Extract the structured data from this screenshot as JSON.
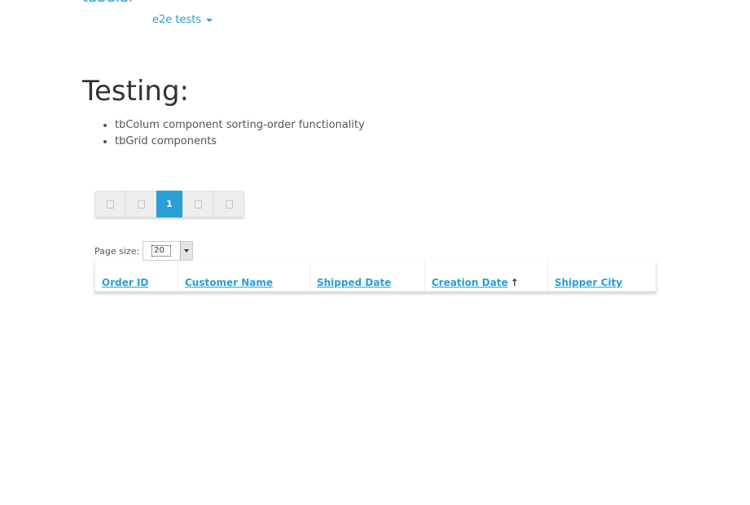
{
  "brand": "tabular",
  "nav": {
    "dropdown_label": "e2e tests"
  },
  "main": {
    "title": "Testing:",
    "testing_items": [
      "tbColum component sorting-order functionality",
      "tbGrid components"
    ]
  },
  "pager": {
    "current_page": "1"
  },
  "page_size": {
    "label": "Page size:",
    "value": "20"
  },
  "grid": {
    "columns": [
      "Order ID",
      "Customer Name",
      "Shipped Date",
      "Creation Date",
      "Shipper City"
    ],
    "sorted_column": "Creation Date",
    "sort_direction": "ascending",
    "rows": []
  },
  "colors": {
    "accent": "#2a9fd6",
    "text": "#333333"
  }
}
